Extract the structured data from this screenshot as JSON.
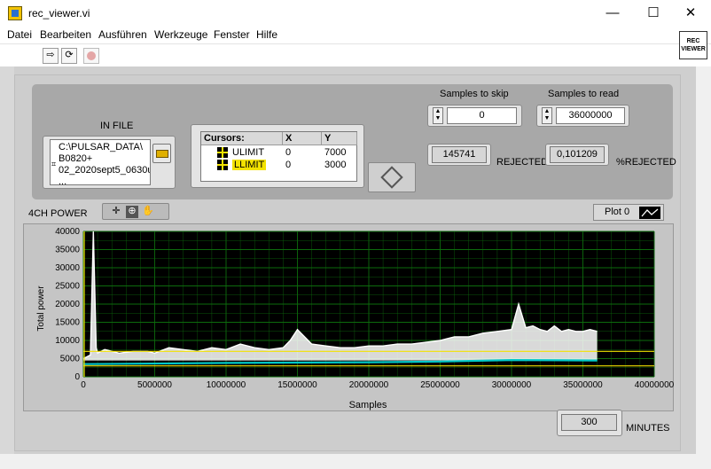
{
  "window": {
    "title": "rec_viewer.vi",
    "minimize": "—",
    "maximize": "☐",
    "close": "✕"
  },
  "menu": [
    "Datei",
    "Bearbeiten",
    "Ausführen",
    "Werkzeuge",
    "Fenster",
    "Hilfe"
  ],
  "toolbar": {
    "run_icon": "run-arrow-icon",
    "run_continuously_icon": "run-continuously-icon",
    "abort_icon": "abort-icon",
    "vi_icon_text": "REC\nVIEWER"
  },
  "in_file": {
    "label": "IN FILE",
    "path": "C:\\PULSAR_DATA\\\nB0820+\n02_2020sept5_0630u\n..."
  },
  "cursors": {
    "headers": [
      "Cursors:",
      "X",
      "Y"
    ],
    "rows": [
      {
        "name": "ULIMIT",
        "x": "0",
        "y": "7000"
      },
      {
        "name": "LLIMIT",
        "x": "0",
        "y": "3000"
      }
    ]
  },
  "samples_to_skip": {
    "label": "Samples to skip",
    "value": "0"
  },
  "samples_to_read": {
    "label": "Samples to read",
    "value": "36000000"
  },
  "rejected": {
    "value": "145741",
    "label": "REJECTED"
  },
  "percent_rejected": {
    "value": "0,101209",
    "label": "%REJECTED"
  },
  "minutes": {
    "value": "300",
    "label": "MINUTES"
  },
  "graph": {
    "label": "4CH POWER",
    "legend_label": "Plot 0",
    "background_color": "#000000",
    "grid_color": "#0d6b0d",
    "cursor_color": "#f3e200"
  },
  "chart_data": {
    "type": "line",
    "title": "4CH POWER",
    "xlabel": "Samples",
    "ylabel": "Total power",
    "xlim": [
      0,
      40000000
    ],
    "ylim": [
      0,
      40000
    ],
    "x_ticks": [
      "0",
      "5000000",
      "10000000",
      "15000000",
      "20000000",
      "25000000",
      "30000000",
      "35000000",
      "40000000"
    ],
    "y_ticks": [
      "0",
      "5000",
      "10000",
      "15000",
      "20000",
      "25000",
      "30000",
      "35000",
      "40000"
    ],
    "grid": true,
    "cursors": [
      {
        "name": "ULIMIT",
        "y": 7000
      },
      {
        "name": "LLIMIT",
        "y": 3000
      }
    ],
    "series": [
      {
        "name": "Plot 0",
        "color": "#ffffff",
        "x": [
          0,
          500000,
          700000,
          900000,
          1000000,
          1500000,
          2500000,
          3500000,
          4500000,
          5000000,
          6000000,
          7000000,
          8000000,
          9000000,
          10000000,
          11000000,
          12000000,
          13000000,
          14000000,
          14500000,
          15000000,
          16000000,
          17000000,
          18000000,
          19000000,
          20000000,
          21000000,
          22000000,
          23000000,
          24000000,
          25000000,
          26000000,
          27000000,
          28000000,
          29000000,
          30000000,
          30500000,
          31000000,
          31500000,
          32000000,
          32500000,
          33000000,
          33500000,
          34000000,
          34500000,
          35000000,
          35500000,
          36000000
        ],
        "y": [
          5000,
          6000,
          40000,
          8000,
          6500,
          7500,
          6500,
          7000,
          7000,
          6500,
          8000,
          7500,
          7000,
          8000,
          7500,
          9000,
          8000,
          7500,
          8000,
          10000,
          13000,
          9000,
          8500,
          8000,
          8000,
          8500,
          8500,
          9000,
          9000,
          9500,
          10000,
          11000,
          11000,
          12000,
          12500,
          13000,
          20000,
          13500,
          14000,
          13000,
          12500,
          14000,
          12500,
          13000,
          12500,
          12500,
          13000,
          12500
        ]
      },
      {
        "name": "",
        "color": "#00c8c8",
        "x": [
          0,
          10000000,
          20000000,
          25000000,
          30000000,
          36000000
        ],
        "y": [
          3500,
          3800,
          4000,
          4200,
          4600,
          4500
        ]
      }
    ]
  }
}
